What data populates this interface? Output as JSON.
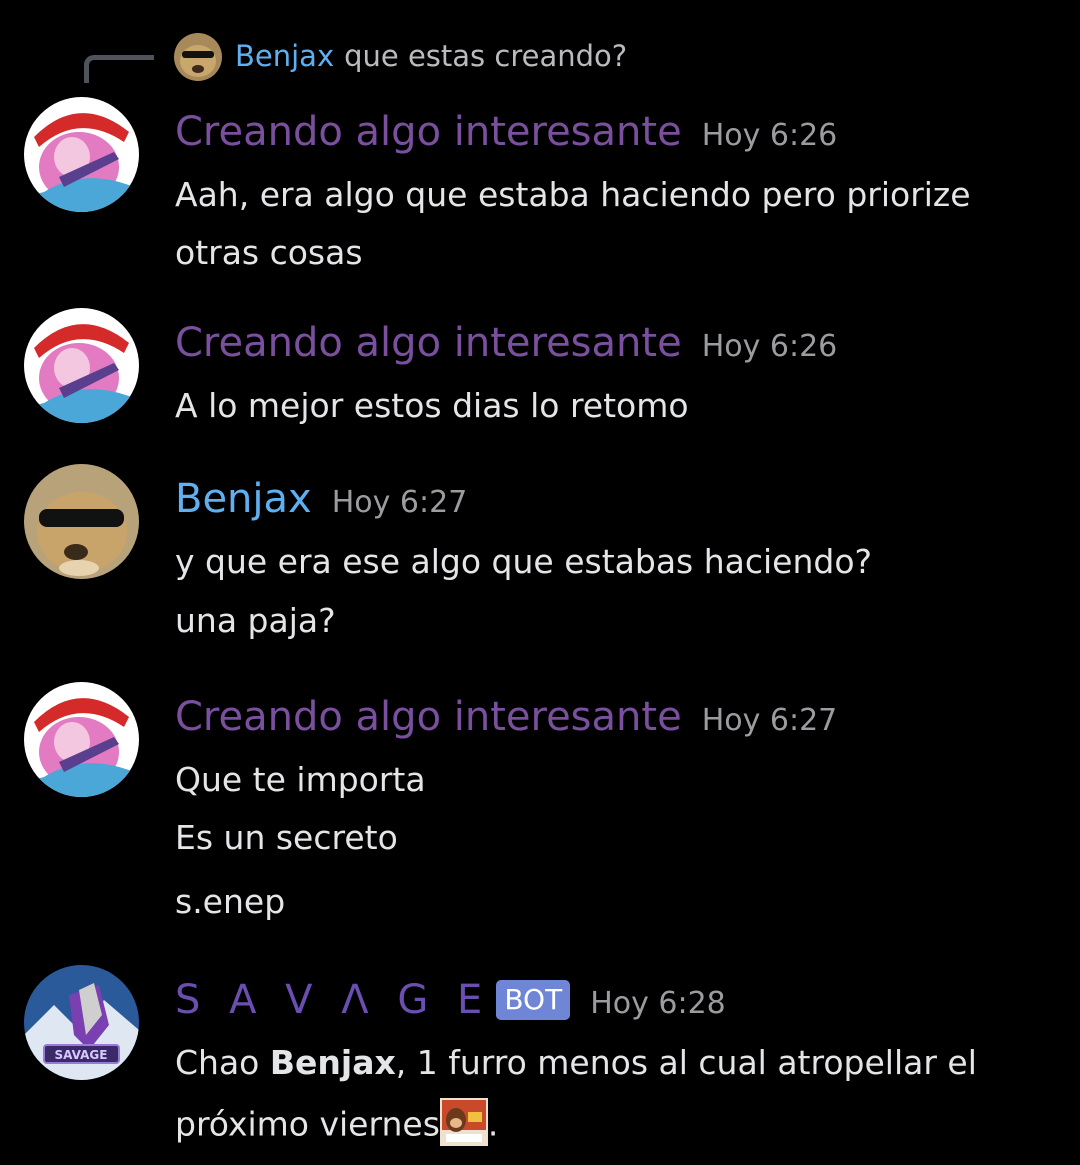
{
  "reply": {
    "author": "Benjax",
    "text": "que estas creando?"
  },
  "messages": [
    {
      "author": "Creando algo interesante",
      "time": "Hoy 6:26",
      "lines": [
        "Aah, era algo que estaba haciendo pero priorize",
        "otras cosas"
      ]
    },
    {
      "author": "Creando algo interesante",
      "time": "Hoy 6:26",
      "lines": [
        "A lo mejor estos dias lo retomo"
      ]
    },
    {
      "author": "Benjax",
      "time": "Hoy 6:27",
      "lines": [
        "y que era ese algo que estabas haciendo?",
        "una paja?"
      ]
    },
    {
      "author": "Creando algo interesante",
      "time": "Hoy 6:27",
      "lines": [
        "Que te importa",
        "Es un secreto",
        "s.enep"
      ]
    },
    {
      "author": "S A V Λ G E",
      "bot_tag": "BOT",
      "time": "Hoy 6:28",
      "line1_prefix": "Chao ",
      "line1_mention": "Benjax",
      "line1_suffix": ", 1 furro menos al cual atropellar el",
      "line2_text": "próximo viernes",
      "line2_end": ".",
      "emoji": "donkey-kong-thumbs-up-emoji",
      "avatar_badge": "SAVAGE"
    }
  ],
  "colors": {
    "creando_name": "#7a4f9e",
    "benjax_name": "#5fb0f0",
    "savage_name": "#6a4fb0",
    "bot_tag_bg": "#6f86d6",
    "background": "#000000"
  }
}
